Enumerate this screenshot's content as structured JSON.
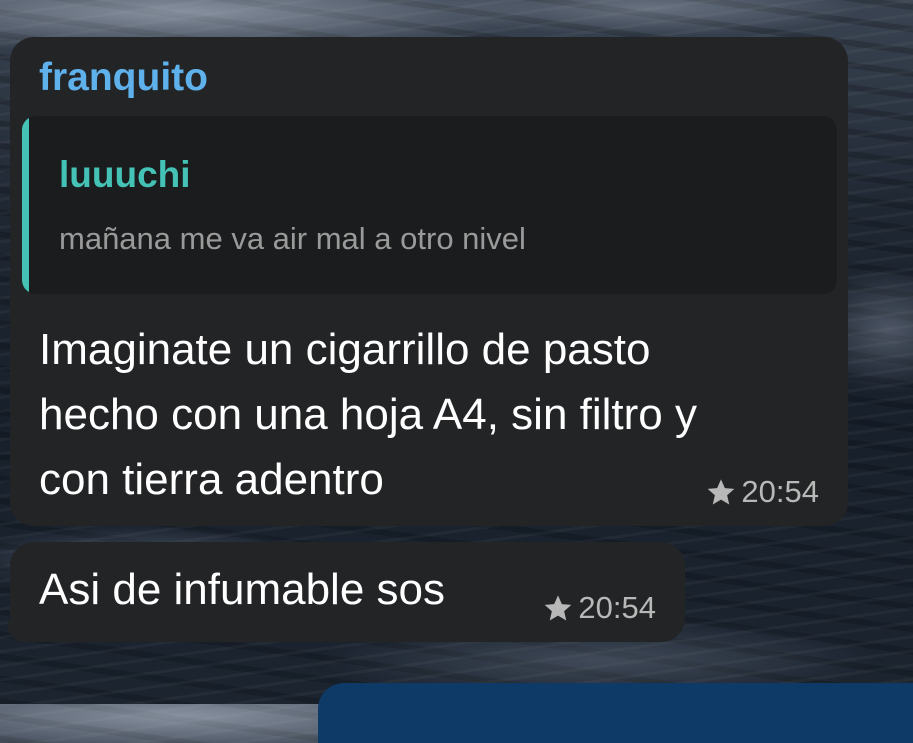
{
  "messages": [
    {
      "sender": "franquito",
      "reply": {
        "author": "luuuchi",
        "text": "mañana me va air mal a otro nivel"
      },
      "text_lines": [
        "Imaginate un cigarrillo de pasto",
        "hecho con una hoja A4, sin filtro y",
        "con tierra adentro"
      ],
      "time": "20:54",
      "starred": true
    },
    {
      "text": "Asi de infumable sos",
      "time": "20:54",
      "starred": true
    }
  ],
  "colors": {
    "sender_name": "#5fb1ec",
    "reply_accent": "#45c2b6",
    "bubble_background": "#232425",
    "outgoing_bubble": "#0d3a66"
  },
  "icons": {
    "star": "star-icon"
  }
}
